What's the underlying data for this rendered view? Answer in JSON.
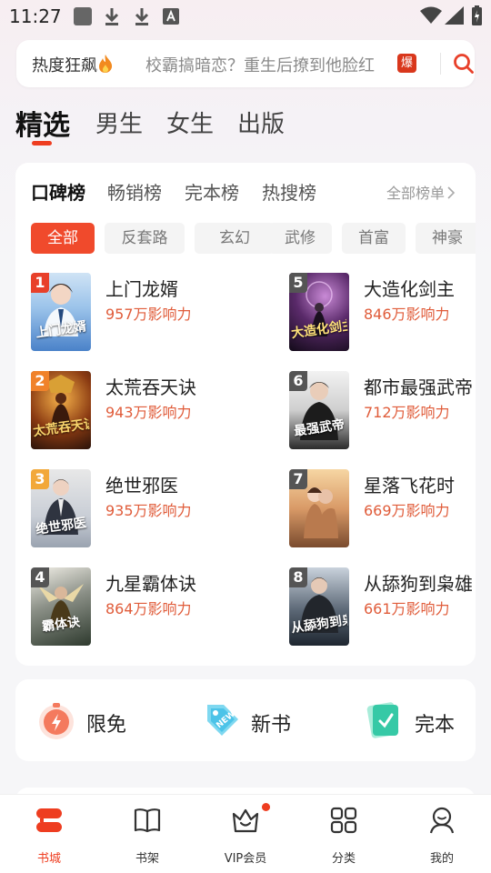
{
  "status_bar": {
    "time": "11:27"
  },
  "search": {
    "hot_label": "热度狂飙",
    "query": "校霸搞暗恋？重生后撩到他脸红",
    "badge": "爆"
  },
  "main_tabs": [
    {
      "label": "精选",
      "active": true
    },
    {
      "label": "男生"
    },
    {
      "label": "女生"
    },
    {
      "label": "出版"
    }
  ],
  "rank_card": {
    "tabs": [
      {
        "label": "口碑榜",
        "active": true
      },
      {
        "label": "畅销榜"
      },
      {
        "label": "完本榜"
      },
      {
        "label": "热搜榜"
      }
    ],
    "all_rank_label": "全部榜单",
    "chips": [
      {
        "label": "全部",
        "active": true
      },
      {
        "label": "反套路"
      },
      {
        "label": "玄幻"
      },
      {
        "label": "武修"
      },
      {
        "label": "首富"
      },
      {
        "label": "神豪"
      }
    ],
    "books": [
      {
        "rank": "1",
        "title": "上门龙婿",
        "stat": "957万影响力",
        "cover_text": "上门龙婿",
        "badge_color": "#e8402a"
      },
      {
        "rank": "2",
        "title": "太荒吞天诀",
        "stat": "943万影响力",
        "cover_text": "太荒吞天诀",
        "badge_color": "#f0822a"
      },
      {
        "rank": "3",
        "title": "绝世邪医",
        "stat": "935万影响力",
        "cover_text": "绝世邪医",
        "badge_color": "#f2a83a"
      },
      {
        "rank": "4",
        "title": "九星霸体诀",
        "stat": "864万影响力",
        "cover_text": "霸体诀",
        "badge_color": "#555555"
      },
      {
        "rank": "5",
        "title": "大造化剑主",
        "stat": "846万影响力",
        "cover_text": "大造化剑主",
        "badge_color": "#555555"
      },
      {
        "rank": "6",
        "title": "都市最强武帝",
        "stat": "712万影响力",
        "cover_text": "最强武帝",
        "badge_color": "#555555"
      },
      {
        "rank": "7",
        "title": "星落飞花时",
        "stat": "669万影响力",
        "cover_text": "",
        "badge_color": "#555555"
      },
      {
        "rank": "8",
        "title": "从舔狗到枭雄",
        "stat": "661万影响力",
        "cover_text": "从舔狗到枭雄",
        "badge_color": "#555555"
      }
    ]
  },
  "quick_entries": [
    {
      "label": "限免",
      "icon": "stopwatch-icon"
    },
    {
      "label": "新书",
      "icon": "new-tag-icon"
    },
    {
      "label": "完本",
      "icon": "book-check-icon"
    }
  ],
  "bottom_nav": [
    {
      "label": "书城",
      "icon": "bookstore-icon",
      "active": true
    },
    {
      "label": "书架",
      "icon": "bookshelf-icon"
    },
    {
      "label": "VIP会员",
      "icon": "vip-crown-icon",
      "dot": true
    },
    {
      "label": "分类",
      "icon": "category-grid-icon"
    },
    {
      "label": "我的",
      "icon": "profile-icon"
    }
  ],
  "colors": {
    "accent": "#ee3d20",
    "stat": "#e05c3a"
  }
}
